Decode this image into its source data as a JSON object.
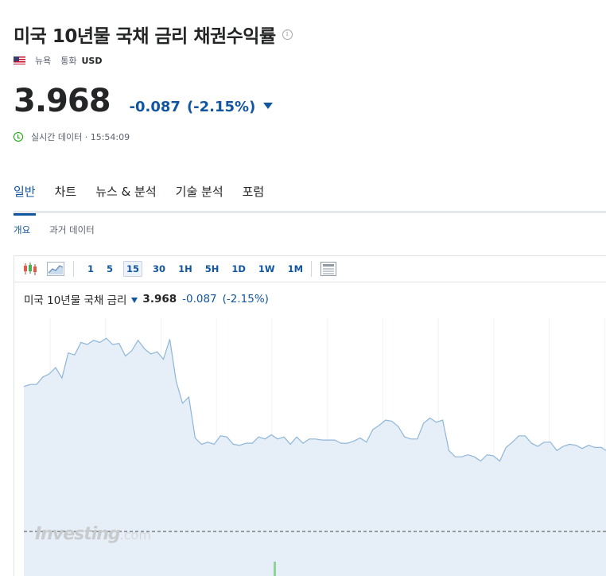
{
  "header": {
    "title": "미국 10년물 국채 금리 채권수익률",
    "info_icon": "info-icon",
    "region": "뉴욕",
    "currency_label": "통화",
    "currency": "USD"
  },
  "quote": {
    "price": "3.968",
    "change": "-0.087",
    "change_pct": "(-2.15%)",
    "direction": "down",
    "realtime_text": "실시간 데이터 · 15:54:09"
  },
  "tabs": [
    {
      "label": "일반",
      "active": true
    },
    {
      "label": "차트",
      "active": false
    },
    {
      "label": "뉴스 & 분석",
      "active": false
    },
    {
      "label": "기술 분석",
      "active": false
    },
    {
      "label": "포럼",
      "active": false
    }
  ],
  "subtabs": [
    {
      "label": "개요",
      "active": true
    },
    {
      "label": "과거 데이터",
      "active": false
    }
  ],
  "chart": {
    "intervals": [
      "1",
      "5",
      "15",
      "30",
      "1H",
      "5H",
      "1D",
      "1W",
      "1M"
    ],
    "active_interval": "15",
    "header_name": "미국 10년물 국채 금리",
    "header_price": "3.968",
    "header_change": "-0.087",
    "header_change_pct": "(-2.15%)",
    "watermark": "Investing",
    "watermark_suffix": ".com",
    "colors": {
      "line": "#8fb6d9",
      "fill": "#e6eff7",
      "down": "#1256a0",
      "up": "#0ea600"
    }
  },
  "chart_data": {
    "type": "area",
    "title": "",
    "xlabel": "",
    "ylabel": "",
    "ylim": [
      3.9,
      4.15
    ],
    "series": [
      {
        "values": [
          4.085,
          4.087,
          4.087,
          4.094,
          4.097,
          4.103,
          4.093,
          4.117,
          4.115,
          4.127,
          4.125,
          4.129,
          4.127,
          4.131,
          4.125,
          4.126,
          4.114,
          4.119,
          4.129,
          4.121,
          4.116,
          4.118,
          4.111,
          4.13,
          4.09,
          4.069,
          4.075,
          4.036,
          4.03,
          4.032,
          4.03,
          4.038,
          4.037,
          4.03,
          4.029,
          4.031,
          4.031,
          4.037,
          4.035,
          4.039,
          4.035,
          4.037,
          4.03,
          4.037,
          4.031,
          4.035,
          4.035,
          4.034,
          4.034,
          4.034,
          4.031,
          4.031,
          4.033,
          4.036,
          4.032,
          4.044,
          4.048,
          4.053,
          4.052,
          4.047,
          4.037,
          4.035,
          4.035,
          4.05,
          4.055,
          4.051,
          4.053,
          4.024,
          4.018,
          4.018,
          4.02,
          4.018,
          4.014,
          4.02,
          4.019,
          4.014,
          4.027,
          4.032,
          4.038,
          4.038,
          4.031,
          4.028,
          4.032,
          4.032,
          4.024,
          4.028,
          4.03,
          4.029,
          4.026,
          4.029,
          4.027,
          4.027,
          4.023
        ]
      }
    ]
  }
}
